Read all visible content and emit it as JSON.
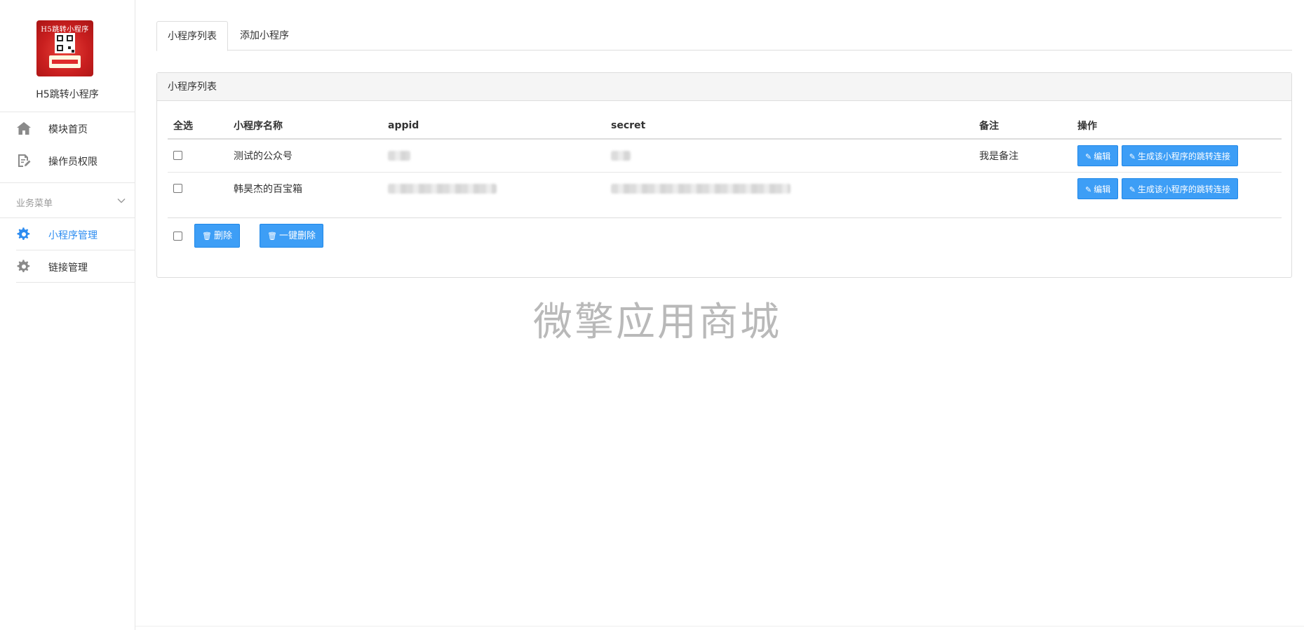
{
  "sidebar": {
    "logo": {
      "title": "H5跳转小程序"
    },
    "app_name": "H5跳转小程序",
    "top_items": [
      {
        "label": "模块首页",
        "icon": "home-icon"
      },
      {
        "label": "操作员权限",
        "icon": "document-edit-icon"
      }
    ],
    "section": {
      "label": "业务菜单",
      "icon": "chevron-down-icon"
    },
    "section_items": [
      {
        "label": "小程序管理",
        "icon": "gear-icon",
        "active": true
      },
      {
        "label": "链接管理",
        "icon": "gear-icon",
        "active": false
      }
    ]
  },
  "tabs": [
    {
      "label": "小程序列表",
      "active": true
    },
    {
      "label": "添加小程序",
      "active": false
    }
  ],
  "panel": {
    "title": "小程序列表",
    "columns": [
      "全选",
      "小程序名称",
      "appid",
      "secret",
      "备注",
      "操作"
    ],
    "rows": [
      {
        "name": "测试的公众号",
        "appid": "",
        "secret": "",
        "note": "我是备注",
        "edit": "编辑",
        "generate": "生成该小程序的跳转连接"
      },
      {
        "name": "韩昊杰的百宝箱",
        "appid": "",
        "secret": "",
        "note": "",
        "edit": "编辑",
        "generate": "生成该小程序的跳转连接"
      }
    ],
    "footer": {
      "delete_label": "删除",
      "bulk_delete_label": "一键删除"
    }
  },
  "watermark": "微擎应用商城",
  "colors": {
    "accent": "#2d8cf0",
    "button": "#3d9ef6",
    "logo": "#c91f1f"
  }
}
